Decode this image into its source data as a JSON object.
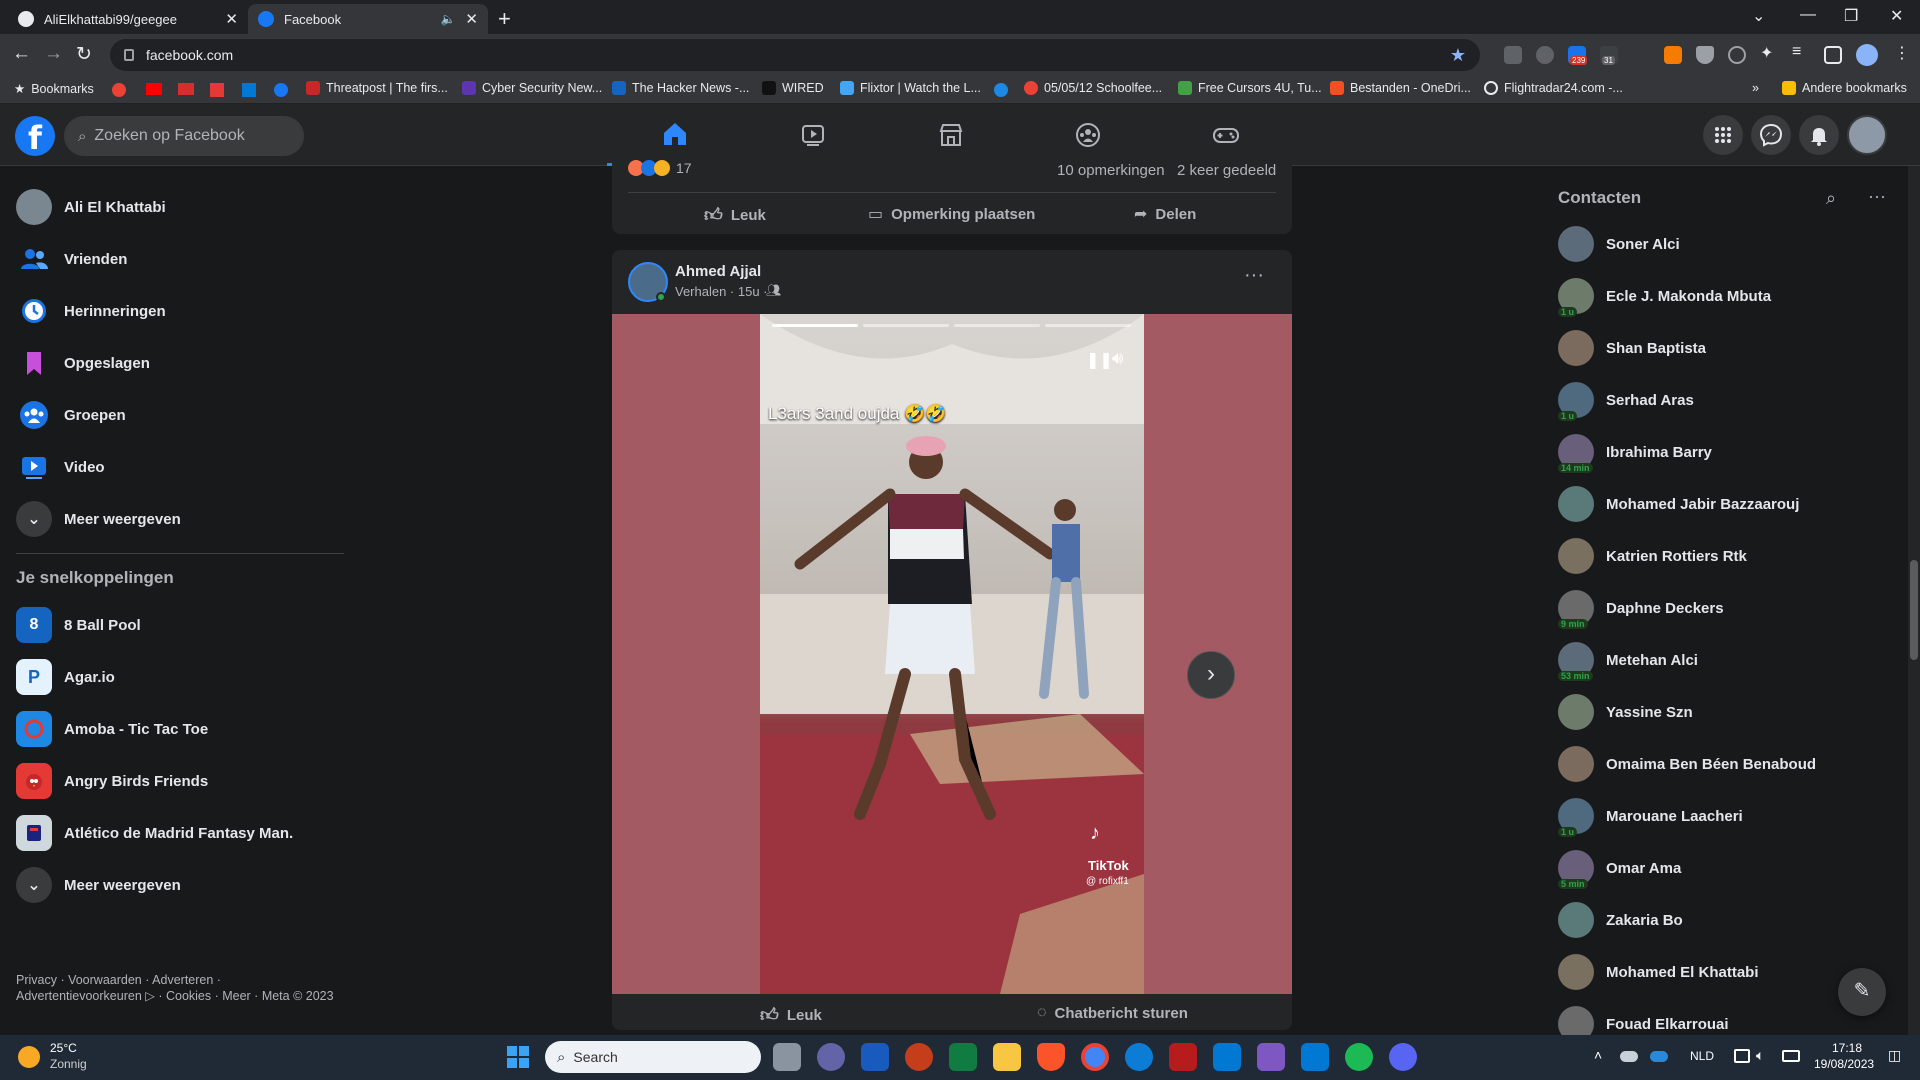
{
  "browser": {
    "tabs": [
      {
        "title": "AliElkhattabi99/geegee"
      },
      {
        "title": "Facebook"
      }
    ],
    "url": "facebook.com",
    "bookmarks": [
      "Bookmarks",
      "Threatpost | The firs...",
      "Cyber Security New...",
      "The Hacker News -...",
      "WIRED",
      "Flixtor | Watch the L...",
      "05/05/12 Schoolfee...",
      "Free Cursors 4U, Tu...",
      "Bestanden - OneDri...",
      "Flightradar24.com -..."
    ],
    "bookmarks_overflow": "»",
    "other_bookmarks": "Andere bookmarks",
    "ext_badges": [
      "239",
      "31"
    ]
  },
  "fb": {
    "search_placeholder": "Zoeken op Facebook",
    "colors": {
      "accent": "#2d88ff",
      "brand": "#1877f2",
      "online": "#31a24c"
    }
  },
  "sidebar": {
    "items": [
      {
        "label": "Ali El Khattabi",
        "icon": "avatar"
      },
      {
        "label": "Vrienden",
        "icon": "friends-icon"
      },
      {
        "label": "Herinneringen",
        "icon": "clock-icon"
      },
      {
        "label": "Opgeslagen",
        "icon": "bookmark-icon"
      },
      {
        "label": "Groepen",
        "icon": "groups-icon"
      },
      {
        "label": "Video",
        "icon": "video-icon"
      },
      {
        "label": "Meer weergeven",
        "icon": "chevron-down-icon"
      }
    ],
    "shortcuts_title": "Je snelkoppelingen",
    "shortcuts": [
      {
        "label": "8 Ball Pool"
      },
      {
        "label": "Agar.io"
      },
      {
        "label": "Amoba - Tic Tac Toe"
      },
      {
        "label": "Angry Birds Friends"
      },
      {
        "label": "Atlético de Madrid Fantasy Man."
      },
      {
        "label": "Meer weergeven"
      }
    ],
    "footer": "Privacy · Voorwaarden · Adverteren · Advertentievoorkeuren ▷ · Cookies · Meer · Meta © 2023"
  },
  "feed": {
    "post1": {
      "reaction_count": "17",
      "comments": "10 opmerkingen",
      "shares": "2 keer gedeeld",
      "like": "Leuk",
      "comment": "Opmerking plaatsen",
      "share": "Delen"
    },
    "post2": {
      "author": "Ahmed Ajjal",
      "meta": "Verhalen · 15u ·",
      "caption": "L3ars 3and oujda 🤣🤣",
      "watermark": "TikTok",
      "handle": "@ rofixff1",
      "like": "Leuk",
      "message": "Chatbericht sturen"
    }
  },
  "contacts": {
    "title": "Contacten",
    "list": [
      {
        "name": "Soner Alci",
        "badge": ""
      },
      {
        "name": "Ecle J. Makonda Mbuta",
        "badge": "1 u"
      },
      {
        "name": "Shan Baptista",
        "badge": ""
      },
      {
        "name": "Serhad Aras",
        "badge": "1 u"
      },
      {
        "name": "Ibrahima Barry",
        "badge": "14 min"
      },
      {
        "name": "Mohamed Jabir Bazzaarouj",
        "badge": ""
      },
      {
        "name": "Katrien Rottiers Rtk",
        "badge": ""
      },
      {
        "name": "Daphne Deckers",
        "badge": "9 min"
      },
      {
        "name": "Metehan Alci",
        "badge": "53 min"
      },
      {
        "name": "Yassine Szn",
        "badge": ""
      },
      {
        "name": "Omaima Ben Béen Benaboud",
        "badge": ""
      },
      {
        "name": "Marouane Laacheri",
        "badge": "1 u"
      },
      {
        "name": "Omar Ama",
        "badge": "5 min"
      },
      {
        "name": "Zakaria Bo",
        "badge": ""
      },
      {
        "name": "Mohamed El Khattabi",
        "badge": ""
      },
      {
        "name": "Fouad Elkarrouai",
        "badge": ""
      }
    ]
  },
  "taskbar": {
    "weather_temp": "25°C",
    "weather_desc": "Zonnig",
    "search": "Search",
    "lang": "NLD",
    "time": "17:18",
    "date": "19/08/2023"
  }
}
